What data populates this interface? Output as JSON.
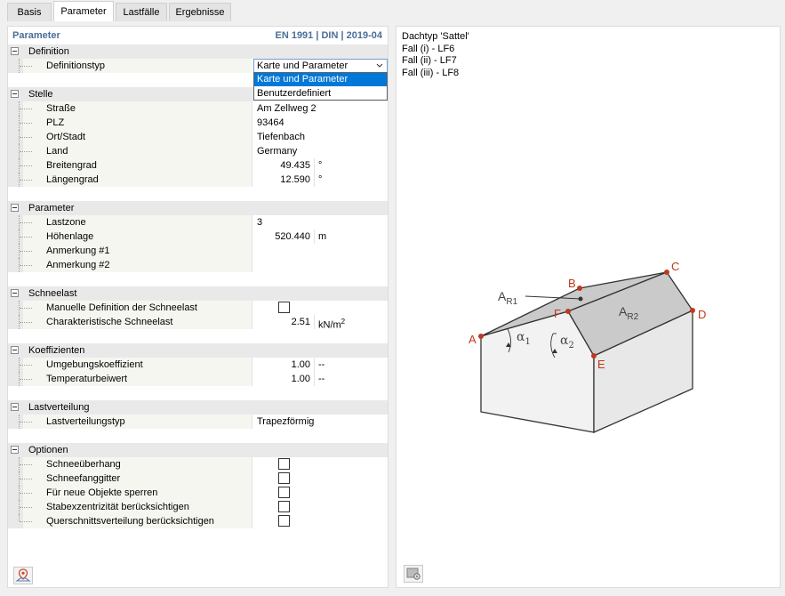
{
  "tabs": [
    "Basis",
    "Parameter",
    "Lastfälle",
    "Ergebnisse"
  ],
  "header": {
    "title": "Parameter",
    "norm": "EN 1991 | DIN | 2019-04"
  },
  "definition": {
    "title": "Definition",
    "label": "Definitionstyp",
    "selected": "Karte und Parameter",
    "options": [
      "Karte und Parameter",
      "Benutzerdefiniert"
    ]
  },
  "stelle": {
    "title": "Stelle",
    "rows": [
      {
        "label": "Straße",
        "value": "Am Zellweg 2"
      },
      {
        "label": "PLZ",
        "value": "93464"
      },
      {
        "label": "Ort/Stadt",
        "value": "Tiefenbach"
      },
      {
        "label": "Land",
        "value": "Germany"
      },
      {
        "label": "Breitengrad",
        "value": "49.435",
        "unit": "°"
      },
      {
        "label": "Längengrad",
        "value": "12.590",
        "unit": "°"
      }
    ]
  },
  "parameter": {
    "title": "Parameter",
    "rows": [
      {
        "label": "Lastzone",
        "value": "3"
      },
      {
        "label": "Höhenlage",
        "value": "520.440",
        "unit": "m"
      },
      {
        "label": "Anmerkung #1",
        "value": ""
      },
      {
        "label": "Anmerkung #2",
        "value": ""
      }
    ]
  },
  "schneelast": {
    "title": "Schneelast",
    "rows": [
      {
        "label": "Manuelle Definition der Schneelast",
        "checked": false
      },
      {
        "label": "Charakteristische Schneelast",
        "value": "2.51",
        "unit": "kN/m",
        "unit_sup": "2"
      }
    ]
  },
  "koeffizienten": {
    "title": "Koeffizienten",
    "rows": [
      {
        "label": "Umgebungskoeffizient",
        "value": "1.00",
        "unit": "--"
      },
      {
        "label": "Temperaturbeiwert",
        "value": "1.00",
        "unit": "--"
      }
    ]
  },
  "lastverteilung": {
    "title": "Lastverteilung",
    "rows": [
      {
        "label": "Lastverteilungstyp",
        "value": "Trapezförmig"
      }
    ]
  },
  "optionen": {
    "title": "Optionen",
    "rows": [
      {
        "label": "Schneeüberhang",
        "checked": false
      },
      {
        "label": "Schneefanggitter",
        "checked": false
      },
      {
        "label": "Für neue Objekte sperren",
        "checked": false
      },
      {
        "label": "Stabexzentrizität berücksichtigen",
        "checked": false
      },
      {
        "label": "Querschnittsverteilung berücksichtigen",
        "checked": false
      }
    ]
  },
  "info": {
    "line1": "Dachtyp 'Sattel'",
    "line2": "Fall (i) - LF6",
    "line3": "Fall (ii) - LF7",
    "line4": "Fall (iii) - LF8"
  },
  "diagram_labels": {
    "A": "A",
    "B": "B",
    "C": "C",
    "D": "D",
    "E": "E",
    "F": "F",
    "ar_main": "A",
    "ar1_sub": "R1",
    "ar2_sub": "R2",
    "alpha1": "α",
    "alpha1_sub": "1",
    "alpha2": "α",
    "alpha2_sub": "2"
  },
  "colors": {
    "accent": "#4a6f96",
    "point": "#c0391b",
    "roof": "#c8c8c8",
    "selection": "#0078d7"
  },
  "icons": {
    "pin": "map-pin-icon",
    "image": "image-settings-icon"
  }
}
